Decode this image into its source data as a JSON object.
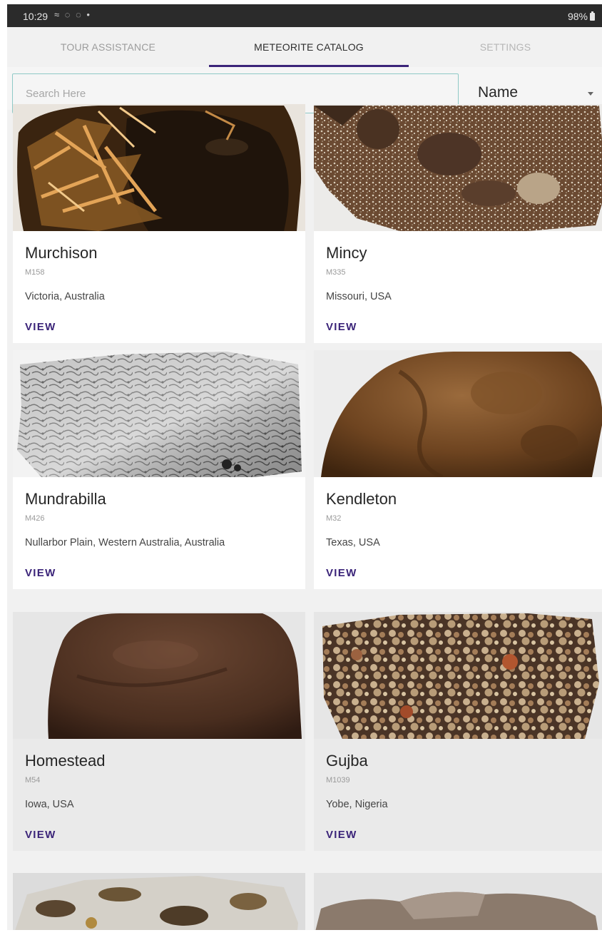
{
  "status_bar": {
    "time": "10:29",
    "indicators": "≈ ◌ ◌ •",
    "battery": "98%"
  },
  "tabs": [
    {
      "label": "TOUR ASSISTANCE",
      "active": false
    },
    {
      "label": "METEORITE CATALOG",
      "active": true
    },
    {
      "label": "SETTINGS",
      "active": false
    }
  ],
  "search": {
    "placeholder": "Search Here",
    "value": ""
  },
  "sort": {
    "selected": "Name"
  },
  "cards": [
    {
      "name": "Murchison",
      "id": "M158",
      "location": "Victoria, Australia",
      "action": "VIEW",
      "image": "murchison-rock"
    },
    {
      "name": "Mincy",
      "id": "M335",
      "location": "Missouri, USA",
      "action": "VIEW",
      "image": "mincy-slice"
    },
    {
      "name": "Mundrabilla",
      "id": "M426",
      "location": "Nullarbor Plain, Western Australia, Australia",
      "action": "VIEW",
      "image": "mundrabilla-slice"
    },
    {
      "name": "Kendleton",
      "id": "M32",
      "location": "Texas, USA",
      "action": "VIEW",
      "image": "kendleton-rock"
    },
    {
      "name": "Homestead",
      "id": "M54",
      "location": "Iowa, USA",
      "action": "VIEW",
      "image": "homestead-rock"
    },
    {
      "name": "Gujba",
      "id": "M1039",
      "location": "Yobe, Nigeria",
      "action": "VIEW",
      "image": "gujba-slice"
    }
  ],
  "colors": {
    "accent": "#3b2479",
    "search_border": "#8fc9c6",
    "status_bar": "#2b2b2b"
  }
}
